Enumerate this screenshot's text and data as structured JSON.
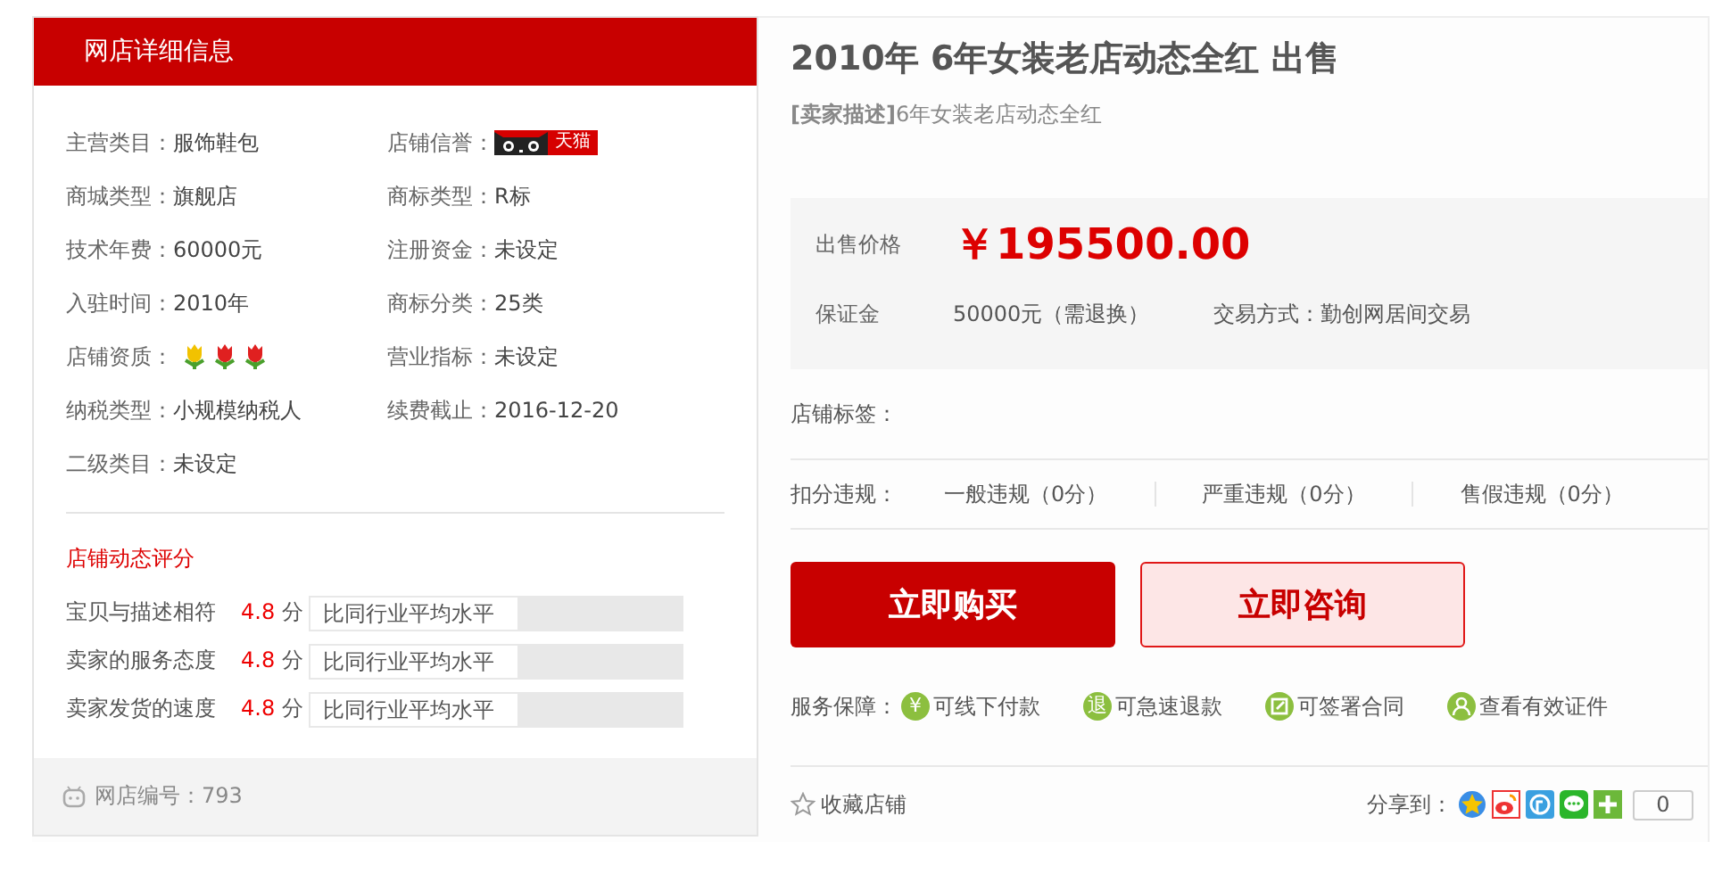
{
  "left_panel": {
    "header": "网店详细信息",
    "info": [
      {
        "label": "主营类目：",
        "value": "服饰鞋包",
        "kind": "text"
      },
      {
        "label": "店铺信誉：",
        "value": "天猫",
        "kind": "badge"
      },
      {
        "label": "商城类型：",
        "value": "旗舰店",
        "kind": "text"
      },
      {
        "label": "商标类型：",
        "value": "R标",
        "kind": "text"
      },
      {
        "label": "技术年费：",
        "value": "60000元",
        "kind": "text"
      },
      {
        "label": "注册资金：",
        "value": "未设定",
        "kind": "text"
      },
      {
        "label": "入驻时间：",
        "value": "2010年",
        "kind": "text"
      },
      {
        "label": "商标分类：",
        "value": "25类",
        "kind": "text"
      },
      {
        "label": "店铺资质：",
        "kind": "flowers",
        "flowers": [
          {
            "color": "#f2c200"
          },
          {
            "color": "#e02020"
          },
          {
            "color": "#e02020"
          }
        ]
      },
      {
        "label": "营业指标：",
        "value": "未设定",
        "kind": "text"
      },
      {
        "label": "纳税类型：",
        "value": "小规模纳税人",
        "kind": "text"
      },
      {
        "label": "续费截止：",
        "value": "2016-12-20",
        "kind": "text"
      },
      {
        "label": "二级类目：",
        "value": "未设定",
        "kind": "text"
      }
    ],
    "ratings_title": "店铺动态评分",
    "ratings": [
      {
        "label": "宝贝与描述相符",
        "score": "4.8",
        "unit": "分",
        "compare": "比同行业平均水平"
      },
      {
        "label": "卖家的服务态度",
        "score": "4.8",
        "unit": "分",
        "compare": "比同行业平均水平"
      },
      {
        "label": "卖家发货的速度",
        "score": "4.8",
        "unit": "分",
        "compare": "比同行业平均水平"
      }
    ],
    "footer": "网店编号：793"
  },
  "right_panel": {
    "title": "2010年 6年女装老店动态全红 出售",
    "description": "**[卖家描述]**6年女装老店动态全红",
    "price_label": "出售价格",
    "price": "￥195500.00",
    "deposit_label": "保证金",
    "deposit": "50000元（需退换）",
    "trade_mode": "交易方式：勤创网居间交易",
    "tags_label": "店铺标签：",
    "violations_label": "扣分违规：",
    "violations": [
      "一般违规（0分）",
      "严重违规（0分）",
      "售假违规（0分）"
    ],
    "buy_button": "立即购买",
    "consult_button": "立即咨询",
    "services_label": "服务保障：",
    "services": [
      {
        "kind": "glyph",
        "glyph": "¥",
        "label": "可线下付款"
      },
      {
        "kind": "glyph",
        "glyph": "退",
        "label": "可急速退款"
      },
      {
        "kind": "edit",
        "label": "可签署合同"
      },
      {
        "kind": "person",
        "label": "查看有效证件"
      }
    ],
    "favorite": "收藏店铺",
    "share_label": "分享到：",
    "share_count": "0"
  }
}
